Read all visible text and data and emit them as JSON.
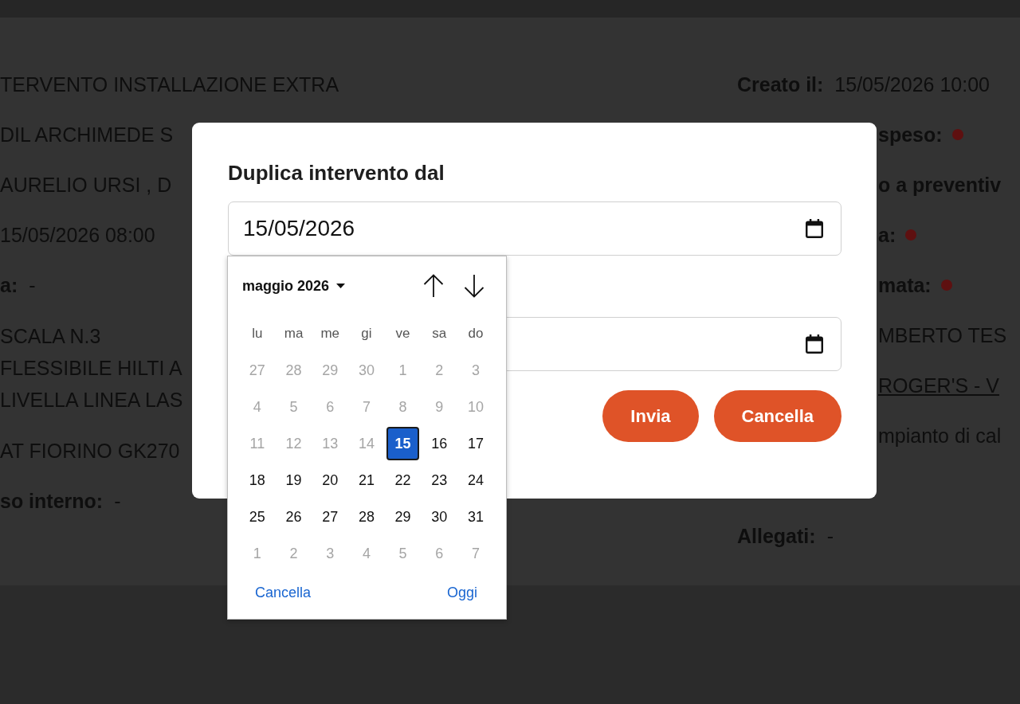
{
  "page": {
    "left_column": [
      {
        "kind": "text",
        "value": "TERVENTO INSTALLAZIONE EXTRA"
      },
      {
        "kind": "text",
        "value": "DIL ARCHIMEDE S"
      },
      {
        "kind": "text",
        "value": "AURELIO URSI , D"
      },
      {
        "kind": "text",
        "value": "15/05/2026 08:00"
      },
      {
        "kind": "field",
        "label": "a:",
        "value": "-"
      },
      {
        "kind": "lines",
        "lines": [
          "SCALA N.3",
          "FLESSIBILE HILTI A",
          "LIVELLA LINEA LAS"
        ]
      },
      {
        "kind": "text",
        "value": "AT FIORINO GK270"
      },
      {
        "kind": "field",
        "label": "so interno:",
        "value": "-"
      }
    ],
    "right_column": [
      [
        {
          "kind": "field",
          "label": "Creato il:",
          "value": "15/05/2026 10:00"
        },
        {
          "kind": "status",
          "label": "speso:",
          "color": "#5e1010"
        },
        {
          "kind": "label",
          "label": "o a preventiv"
        },
        {
          "kind": "status",
          "label": "a:",
          "color": "#5e1010"
        },
        {
          "kind": "status",
          "label": "mata:",
          "color": "#5e1010"
        },
        {
          "kind": "text",
          "value": "MBERTO TES"
        },
        {
          "kind": "link",
          "value": "ROGER'S - V"
        },
        {
          "kind": "text",
          "value": "mpianto di cal"
        }
      ],
      [
        {
          "kind": "field",
          "label": "Allegati:",
          "value": "-"
        }
      ]
    ]
  },
  "dialog": {
    "title": "Duplica intervento dal",
    "date_fields": [
      {
        "value": "15/05/2026",
        "expanded": true
      },
      {
        "expanded": false
      }
    ],
    "calendar": {
      "month_label": "maggio 2026",
      "weekdays": [
        "lu",
        "ma",
        "me",
        "gi",
        "ve",
        "sa",
        "do"
      ],
      "weeks": [
        [
          {
            "label": "27",
            "disabled": true,
            "selected": false
          },
          {
            "label": "28",
            "disabled": true,
            "selected": false
          },
          {
            "label": "29",
            "disabled": true,
            "selected": false
          },
          {
            "label": "30",
            "disabled": true,
            "selected": false
          },
          {
            "label": "1",
            "disabled": true,
            "selected": false
          },
          {
            "label": "2",
            "disabled": true,
            "selected": false
          },
          {
            "label": "3",
            "disabled": true,
            "selected": false
          }
        ],
        [
          {
            "label": "4",
            "disabled": true,
            "selected": false
          },
          {
            "label": "5",
            "disabled": true,
            "selected": false
          },
          {
            "label": "6",
            "disabled": true,
            "selected": false
          },
          {
            "label": "7",
            "disabled": true,
            "selected": false
          },
          {
            "label": "8",
            "disabled": true,
            "selected": false
          },
          {
            "label": "9",
            "disabled": true,
            "selected": false
          },
          {
            "label": "10",
            "disabled": true,
            "selected": false
          }
        ],
        [
          {
            "label": "11",
            "disabled": true,
            "selected": false
          },
          {
            "label": "12",
            "disabled": true,
            "selected": false
          },
          {
            "label": "13",
            "disabled": true,
            "selected": false
          },
          {
            "label": "14",
            "disabled": true,
            "selected": false
          },
          {
            "label": "15",
            "disabled": false,
            "selected": true
          },
          {
            "label": "16",
            "disabled": false,
            "selected": false
          },
          {
            "label": "17",
            "disabled": false,
            "selected": false
          }
        ],
        [
          {
            "label": "18",
            "disabled": false,
            "selected": false
          },
          {
            "label": "19",
            "disabled": false,
            "selected": false
          },
          {
            "label": "20",
            "disabled": false,
            "selected": false
          },
          {
            "label": "21",
            "disabled": false,
            "selected": false
          },
          {
            "label": "22",
            "disabled": false,
            "selected": false
          },
          {
            "label": "23",
            "disabled": false,
            "selected": false
          },
          {
            "label": "24",
            "disabled": false,
            "selected": false
          }
        ],
        [
          {
            "label": "25",
            "disabled": false,
            "selected": false
          },
          {
            "label": "26",
            "disabled": false,
            "selected": false
          },
          {
            "label": "27",
            "disabled": false,
            "selected": false
          },
          {
            "label": "28",
            "disabled": false,
            "selected": false
          },
          {
            "label": "29",
            "disabled": false,
            "selected": false
          },
          {
            "label": "30",
            "disabled": false,
            "selected": false
          },
          {
            "label": "31",
            "disabled": false,
            "selected": false
          }
        ],
        [
          {
            "label": "1",
            "disabled": true,
            "selected": false
          },
          {
            "label": "2",
            "disabled": true,
            "selected": false
          },
          {
            "label": "3",
            "disabled": true,
            "selected": false
          },
          {
            "label": "4",
            "disabled": true,
            "selected": false
          },
          {
            "label": "5",
            "disabled": true,
            "selected": false
          },
          {
            "label": "6",
            "disabled": true,
            "selected": false
          },
          {
            "label": "7",
            "disabled": true,
            "selected": false
          }
        ]
      ],
      "actions": [
        "Cancella",
        "Oggi"
      ]
    },
    "buttons": [
      "Invia",
      "Cancella"
    ]
  }
}
